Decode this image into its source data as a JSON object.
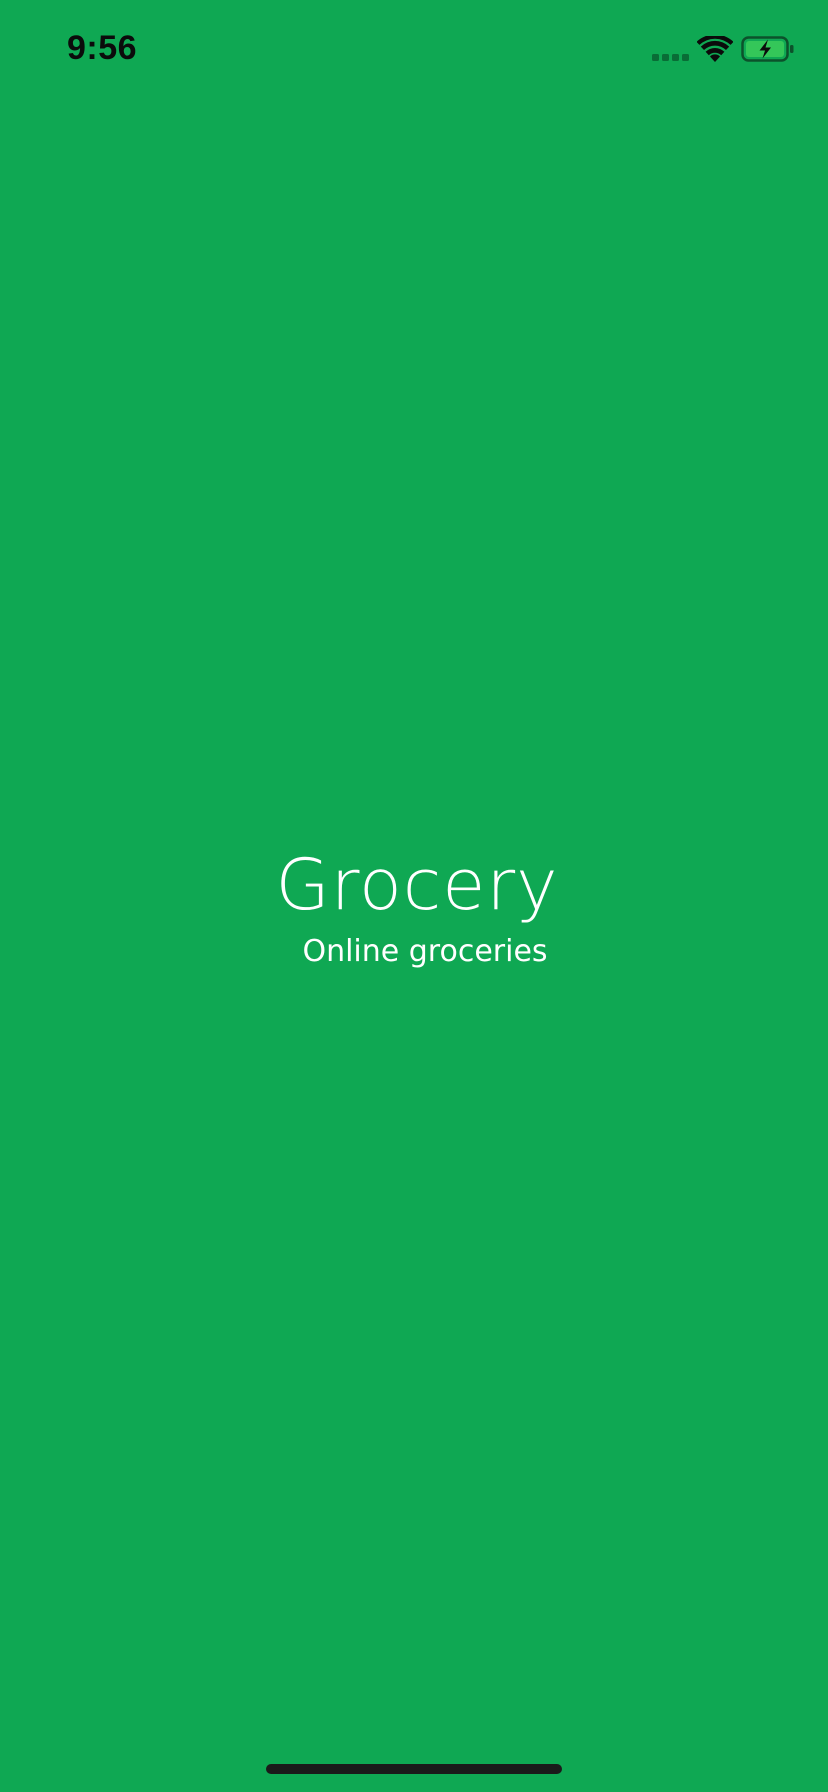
{
  "status_bar": {
    "time": "9:56",
    "icons": [
      "signal-icon",
      "wifi-icon",
      "battery-charging-icon"
    ]
  },
  "brand": {
    "title": "Grocery",
    "subtitle": "Online groceries"
  },
  "colors": {
    "background": "#0fa853",
    "text": "#ffffff",
    "status_text": "#0b0b0b",
    "battery_fill": "#34c759"
  }
}
